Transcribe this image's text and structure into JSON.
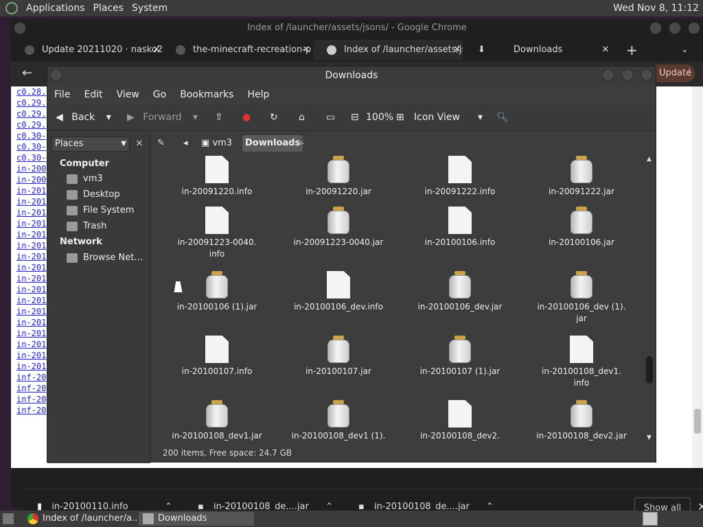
{
  "top_panel": {
    "menus": [
      "Applications",
      "Places",
      "System"
    ],
    "clock": "Wed Nov 8, 11:12"
  },
  "chrome": {
    "title": "Index of /launcher/assets/jsons/ - Google Chrome",
    "tabs": [
      {
        "label": "Update 20211020 · nasko22",
        "icon": "github-icon"
      },
      {
        "label": "the-minecraft-recreation-p",
        "icon": "github-icon"
      },
      {
        "label": "Index of /launcher/assets/js",
        "icon": "globe-icon"
      },
      {
        "label": "Downloads",
        "icon": "download-icon"
      }
    ],
    "update_label": "Update",
    "page_links": [
      "c0.28.",
      "c0.29.",
      "c0.29.",
      "c0.29.",
      "c0.30-",
      "c0.30-",
      "c0.30-",
      "in-200",
      "in-200",
      "in-201",
      "in-201",
      "in-201",
      "in-201",
      "in-201",
      "in-201",
      "in-201",
      "in-201",
      "in-201",
      "in-201",
      "in-201",
      "in-201",
      "in-201",
      "in-201",
      "in-201",
      "in-201",
      "in-201",
      "inf-20",
      "inf-20",
      "inf-20",
      "inf-20"
    ],
    "downloads": [
      {
        "name": "in-20100110.info"
      },
      {
        "name": "in-20100108_de....jar"
      },
      {
        "name": "in-20100108_de....jar"
      }
    ],
    "show_all": "Show all"
  },
  "file_manager": {
    "title": "Downloads",
    "menubar": [
      "File",
      "Edit",
      "View",
      "Go",
      "Bookmarks",
      "Help"
    ],
    "toolbar": {
      "back": "Back",
      "forward": "Forward",
      "zoom": "100%",
      "view_mode": "Icon View"
    },
    "places_label": "Places",
    "sidebar": {
      "computer_header": "Computer",
      "computer_items": [
        "vm3",
        "Desktop",
        "File System",
        "Trash"
      ],
      "network_header": "Network",
      "network_items": [
        "Browse Net…"
      ]
    },
    "breadcrumbs": [
      "vm3",
      "Downloads"
    ],
    "files": [
      {
        "name": "in-20091220.info",
        "type": "doc"
      },
      {
        "name": "in-20091220.jar",
        "type": "jar"
      },
      {
        "name": "in-20091222.info",
        "type": "doc"
      },
      {
        "name": "in-20091222.jar",
        "type": "jar"
      },
      {
        "name": "in-20091223-0040.\ninfo",
        "type": "doc"
      },
      {
        "name": "in-20091223-0040.jar",
        "type": "jar"
      },
      {
        "name": "in-20100106.info",
        "type": "doc"
      },
      {
        "name": "in-20100106.jar",
        "type": "jar"
      },
      {
        "name": "in-20100106 (1).jar",
        "type": "jar"
      },
      {
        "name": "in-20100106_dev.info",
        "type": "doc"
      },
      {
        "name": "in-20100106_dev.jar",
        "type": "jar"
      },
      {
        "name": "in-20100106_dev (1).\njar",
        "type": "jar"
      },
      {
        "name": "in-20100107.info",
        "type": "doc"
      },
      {
        "name": "in-20100107.jar",
        "type": "jar"
      },
      {
        "name": "in-20100107 (1).jar",
        "type": "jar"
      },
      {
        "name": "in-20100108_dev1.\ninfo",
        "type": "doc"
      },
      {
        "name": "in-20100108_dev1.jar",
        "type": "jar"
      },
      {
        "name": "in-20100108_dev1 (1).",
        "type": "jar"
      },
      {
        "name": "in-20100108_dev2.",
        "type": "doc"
      },
      {
        "name": "in-20100108_dev2.jar",
        "type": "jar"
      }
    ],
    "status": "200 items, Free space: 24.7 GB"
  },
  "taskbar": {
    "tasks": [
      {
        "label": "Index of /launcher/a...",
        "icon": "chrome-icon"
      },
      {
        "label": "Downloads",
        "icon": "folder-icon"
      }
    ]
  }
}
